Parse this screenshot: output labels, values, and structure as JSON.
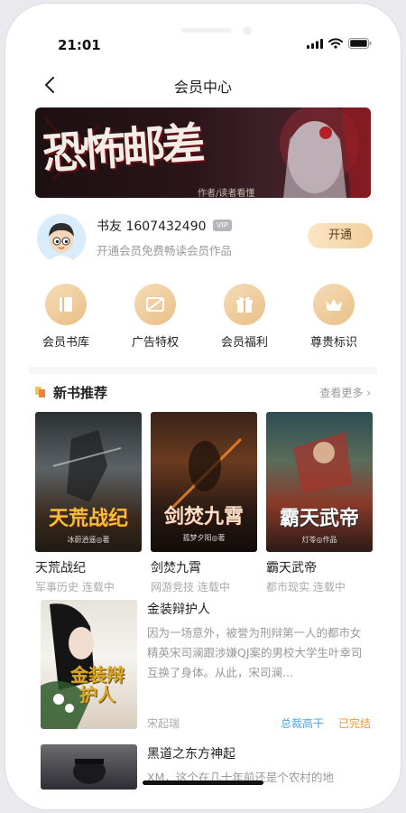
{
  "status_bar": {
    "time": "21:01"
  },
  "header": {
    "title": "会员中心"
  },
  "banner": {
    "title": "恐怖邮差",
    "subtitle": "作者/读者看懂"
  },
  "user": {
    "name": "书友 1607432490",
    "vip_badge": "VIP",
    "subtitle": "开通会员免费畅读会员作品",
    "open_button": "开通"
  },
  "privileges": [
    {
      "label": "会员书库",
      "icon": "book-icon"
    },
    {
      "label": "广告特权",
      "icon": "no-ads-icon"
    },
    {
      "label": "会员福利",
      "icon": "gift-icon"
    },
    {
      "label": "尊贵标识",
      "icon": "crown-icon"
    }
  ],
  "section": {
    "title": "新书推荐",
    "more": "查看更多"
  },
  "books": [
    {
      "title": "天荒战纪",
      "category": "军事历史",
      "status": "连载中",
      "cover_title": "天荒战纪",
      "cover_author": "冰蔚逍遥◎著"
    },
    {
      "title": "剑焚九霄",
      "category": "网游竞技",
      "status": "连载中",
      "cover_title": "剑焚九霄",
      "cover_author": "孤梦夕阳◎著"
    },
    {
      "title": "霸天武帝",
      "category": "都市现实",
      "status": "连载中",
      "cover_title": "霸天武帝",
      "cover_author": "灯苓◎作品"
    }
  ],
  "list": [
    {
      "title": "金装辩护人",
      "description": "因为一场意外，被誉为刑辩第一人的都市女精英宋司澜跟涉嫌QJ案的男校大学生叶幸司互换了身体。从此，宋司澜...",
      "author": "宋起瑞",
      "tag1": "总裁高干",
      "tag2": "已完结",
      "cover_title": "金装辩护人"
    },
    {
      "title": "黑道之东方神起",
      "description": "XM，这个在几十年前还是个农村的地"
    }
  ],
  "colors": {
    "accent_gold": "#f2d09e",
    "tag_blue": "#49a4e8",
    "tag_orange": "#f4963a"
  }
}
